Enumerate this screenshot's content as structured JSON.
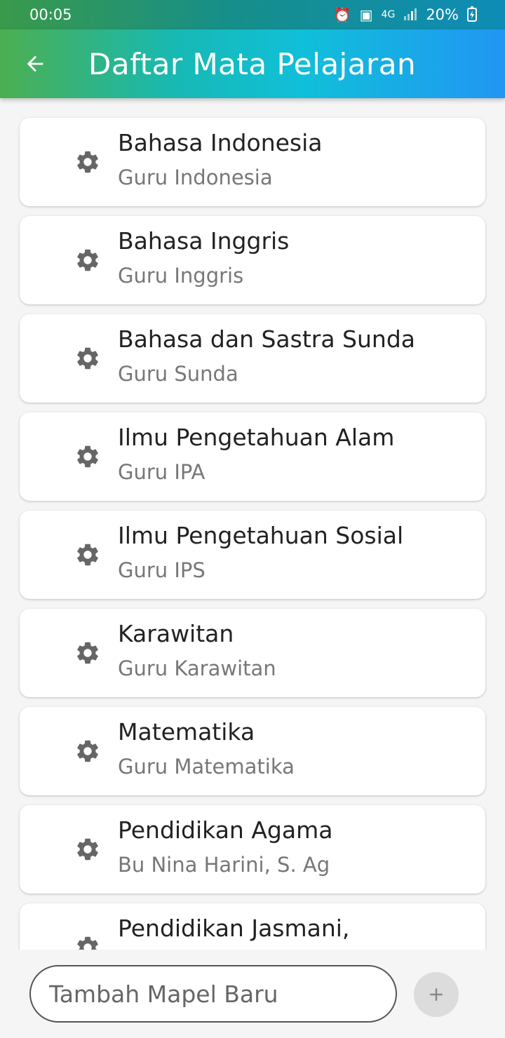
{
  "status_bar": {
    "time": "00:05",
    "battery": "20%",
    "network": "4G"
  },
  "app_bar": {
    "title": "Daftar Mata Pelajaran"
  },
  "subjects": [
    {
      "name": "Bahasa Indonesia",
      "teacher": "Guru Indonesia"
    },
    {
      "name": "Bahasa Inggris",
      "teacher": "Guru Inggris"
    },
    {
      "name": "Bahasa dan Sastra Sunda",
      "teacher": "Guru Sunda"
    },
    {
      "name": "Ilmu Pengetahuan Alam",
      "teacher": "Guru IPA"
    },
    {
      "name": "Ilmu Pengetahuan Sosial",
      "teacher": "Guru IPS"
    },
    {
      "name": "Karawitan",
      "teacher": "Guru Karawitan"
    },
    {
      "name": "Matematika",
      "teacher": "Guru Matematika"
    },
    {
      "name": "Pendidikan Agama",
      "teacher": "Bu Nina Harini, S. Ag"
    },
    {
      "name": "Pendidikan Jasmani,",
      "teacher": ""
    }
  ],
  "add_subject": {
    "placeholder": "Tambah Mapel Baru",
    "value": ""
  },
  "icons": {
    "back": "arrow-left-icon",
    "item": "gear-icon",
    "add": "plus-icon"
  },
  "colors": {
    "appbar_gradient_start": "#4caf50",
    "appbar_gradient_end": "#2196f3",
    "gear": "#666666"
  }
}
